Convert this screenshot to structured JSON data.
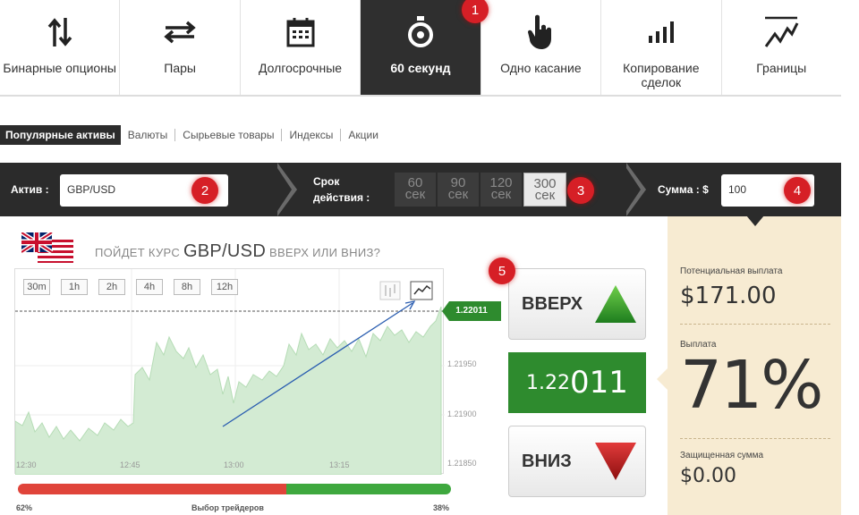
{
  "tabs": [
    {
      "label": "Бинарные опционы",
      "icon": "up-down-arrows-icon"
    },
    {
      "label": "Пары",
      "icon": "swap-arrows-icon"
    },
    {
      "label": "Долгосрочные",
      "icon": "calendar-icon"
    },
    {
      "label": "60 секунд",
      "icon": "stopwatch-icon",
      "active": true
    },
    {
      "label": "Одно касание",
      "icon": "pointer-hand-icon"
    },
    {
      "label": "Копирование сделок",
      "icon": "bar-chart-icon"
    },
    {
      "label": "Границы",
      "icon": "trend-line-icon"
    }
  ],
  "badges": [
    "1",
    "2",
    "3",
    "4",
    "5"
  ],
  "categories": [
    "Популярные активы",
    "Валюты",
    "Сырьевые товары",
    "Индексы",
    "Акции"
  ],
  "trade_bar": {
    "asset_label": "Актив :",
    "asset_value": "GBP/USD",
    "expiry_label_1": "Срок",
    "expiry_label_2": "действия :",
    "expiry_options": [
      {
        "num": "60",
        "unit": "сек"
      },
      {
        "num": "90",
        "unit": "сек"
      },
      {
        "num": "120",
        "unit": "сек"
      },
      {
        "num": "300",
        "unit": "сек",
        "selected": true
      }
    ],
    "amount_label": "Сумма : $",
    "amount_value": "100"
  },
  "headline": {
    "prefix": "ПОЙДЕТ КУРС ",
    "pair": "GBP/USD",
    "suffix": " ВВЕРХ ИЛИ ВНИЗ?"
  },
  "timeframes": [
    "30m",
    "1h",
    "2h",
    "4h",
    "8h",
    "12h"
  ],
  "chart": {
    "current_price_tag": "1.22011",
    "y_ticks": [
      "1.21950",
      "1.21900",
      "1.21850"
    ],
    "x_ticks": [
      "12:30",
      "12:45",
      "13:00",
      "13:15"
    ],
    "area_color": "#cfe8cf"
  },
  "traders_choice": {
    "label": "Выбор трейдеров",
    "left_pct": "62%",
    "right_pct": "38%",
    "left_value": 0.62
  },
  "actions": {
    "up_label": "ВВЕРХ",
    "down_label": "ВНИЗ",
    "price_small": "1.22",
    "price_big": "011"
  },
  "payout_panel": {
    "potential_label": "Потенциальная выплата",
    "potential_value": "$171.00",
    "payout_label": "Выплата",
    "payout_value": "71%",
    "protected_label": "Защищенная сумма",
    "protected_value": "$0.00"
  },
  "colors": {
    "green": "#2e8b2e",
    "red": "#d61f26",
    "dark": "#2b2b2b",
    "panel": "#f7ebd2"
  }
}
